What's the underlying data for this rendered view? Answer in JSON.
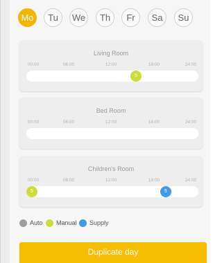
{
  "days": [
    {
      "label": "Mo",
      "active": true
    },
    {
      "label": "Tu",
      "active": false
    },
    {
      "label": "We",
      "active": false
    },
    {
      "label": "Th",
      "active": false
    },
    {
      "label": "Fr",
      "active": false
    },
    {
      "label": "Sa",
      "active": false
    },
    {
      "label": "Su",
      "active": false
    }
  ],
  "time_ticks": [
    "00:00",
    "06:00",
    "12:00",
    "18:00",
    "24:00"
  ],
  "rooms": [
    {
      "name": "Living Room",
      "markers": [
        {
          "label": "5",
          "mode": "manual",
          "time": "15:30"
        }
      ]
    },
    {
      "name": "Bed Room",
      "markers": []
    },
    {
      "name": "Children's Room",
      "markers": [
        {
          "label": "5",
          "mode": "manual",
          "time": "00:00"
        },
        {
          "label": "5",
          "mode": "supply",
          "time": "20:00"
        }
      ]
    }
  ],
  "legend": [
    {
      "label": "Auto",
      "mode": "auto"
    },
    {
      "label": "Manual",
      "mode": "manual"
    },
    {
      "label": "Supply",
      "mode": "supply"
    }
  ],
  "colors": {
    "auto": "#9e9e9e",
    "manual": "#cddc39",
    "supply": "#3d9be9",
    "accent": "#f5b400"
  },
  "duplicate_button": "Duplicate day"
}
